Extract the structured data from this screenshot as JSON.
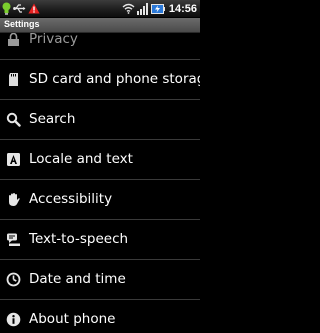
{
  "status_bar": {
    "time": "14:56",
    "left_icons": [
      "bulb-icon",
      "usb-icon",
      "warning-icon"
    ],
    "right_icons": [
      "wifi-icon",
      "signal-icon",
      "battery-icon"
    ]
  },
  "title_bar": {
    "title": "Settings"
  },
  "settings_list": {
    "items": [
      {
        "label": "Privacy",
        "icon": "privacy-icon"
      },
      {
        "label": "SD card and phone storage",
        "icon": "sd-card-icon"
      },
      {
        "label": "Search",
        "icon": "search-icon"
      },
      {
        "label": "Locale and text",
        "icon": "locale-icon"
      },
      {
        "label": "Accessibility",
        "icon": "hand-icon"
      },
      {
        "label": "Text-to-speech",
        "icon": "speech-icon"
      },
      {
        "label": "Date and time",
        "icon": "clock-icon"
      },
      {
        "label": "About phone",
        "icon": "info-icon"
      }
    ]
  },
  "colors": {
    "background": "#000000",
    "text": "#ffffff",
    "divider": "#3a3a3a",
    "title_bar": "#5a5a5a",
    "bulb": "#7ccf2e",
    "warning": "#e82020",
    "battery": "#2a78d8"
  }
}
